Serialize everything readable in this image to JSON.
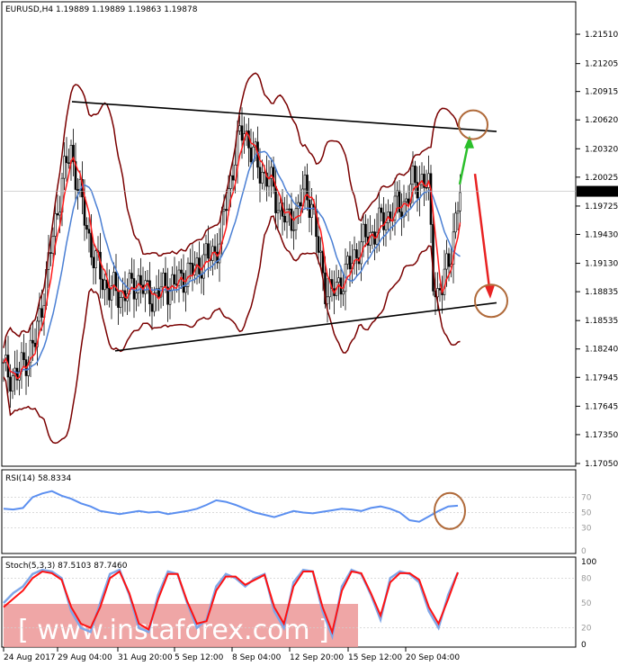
{
  "chart_data": [
    {
      "type": "candlestick",
      "panel": "main",
      "title": "EURUSD,H4  1.19889 1.19889 1.19863 1.19878",
      "last_price_label": "1.19878",
      "yticks": [
        "1.21510",
        "1.21205",
        "1.20915",
        "1.20620",
        "1.20320",
        "1.20025",
        "1.19725",
        "1.19430",
        "1.19130",
        "1.18835",
        "1.18535",
        "1.18240",
        "1.17945",
        "1.17645",
        "1.17350",
        "1.17050"
      ],
      "ylim": [
        1.1705,
        1.2166
      ],
      "price_path": [
        [
          0,
          1.1802
        ],
        [
          6,
          1.1795
        ],
        [
          10,
          1.1815
        ],
        [
          14,
          1.183
        ],
        [
          18,
          1.1885
        ],
        [
          22,
          1.194
        ],
        [
          26,
          1.2
        ],
        [
          30,
          1.203
        ],
        [
          33,
          1.1995
        ],
        [
          36,
          1.196
        ],
        [
          40,
          1.192
        ],
        [
          44,
          1.1895
        ],
        [
          48,
          1.1885
        ],
        [
          52,
          1.188
        ],
        [
          56,
          1.1885
        ],
        [
          60,
          1.1895
        ],
        [
          64,
          1.188
        ],
        [
          68,
          1.188
        ],
        [
          72,
          1.189
        ],
        [
          76,
          1.189
        ],
        [
          80,
          1.19
        ],
        [
          84,
          1.1905
        ],
        [
          88,
          1.1915
        ],
        [
          92,
          1.192
        ],
        [
          96,
          1.1935
        ],
        [
          100,
          1.199
        ],
        [
          104,
          1.2035
        ],
        [
          107,
          1.2055
        ],
        [
          110,
          1.203
        ],
        [
          114,
          1.201
        ],
        [
          118,
          1.2
        ],
        [
          122,
          1.1975
        ],
        [
          126,
          1.1955
        ],
        [
          130,
          1.1965
        ],
        [
          134,
          1.199
        ],
        [
          137,
          1.1975
        ],
        [
          140,
          1.1925
        ],
        [
          143,
          1.189
        ],
        [
          146,
          1.188
        ],
        [
          150,
          1.1895
        ],
        [
          154,
          1.191
        ],
        [
          158,
          1.193
        ],
        [
          162,
          1.194
        ],
        [
          166,
          1.195
        ],
        [
          170,
          1.196
        ],
        [
          174,
          1.197
        ],
        [
          178,
          1.1975
        ],
        [
          182,
          1.1995
        ],
        [
          186,
          1.2
        ],
        [
          189,
          1.199
        ],
        [
          191,
          1.19
        ],
        [
          193,
          1.188
        ],
        [
          195,
          1.1885
        ],
        [
          197,
          1.191
        ],
        [
          199,
          1.193
        ],
        [
          201,
          1.1955
        ],
        [
          203,
          1.1985
        ]
      ],
      "annotations": [
        "upper trendline",
        "lower trendline",
        "green up arrow",
        "red down arrow",
        "brown circles"
      ]
    },
    {
      "type": "line",
      "panel": "rsi",
      "title": "RSI(14) 58.8334",
      "yticks": [
        "70",
        "50",
        "30",
        "0"
      ],
      "ylim": [
        0,
        100
      ],
      "values": [
        55,
        54,
        56,
        70,
        75,
        78,
        72,
        68,
        62,
        58,
        52,
        50,
        48,
        50,
        52,
        50,
        51,
        48,
        50,
        52,
        55,
        60,
        66,
        64,
        60,
        55,
        50,
        47,
        44,
        48,
        52,
        50,
        49,
        51,
        53,
        55,
        54,
        52,
        56,
        58,
        55,
        50,
        40,
        38,
        45,
        52,
        58,
        59
      ]
    },
    {
      "type": "line",
      "panel": "stochastic",
      "title": "Stoch(5,3,3) 87.5103 87.7460",
      "yticks": [
        "100",
        "80",
        "50",
        "20",
        "0"
      ],
      "ylim": [
        0,
        100
      ],
      "series": [
        {
          "values": [
            50,
            62,
            70,
            85,
            90,
            88,
            80,
            40,
            20,
            15,
            50,
            85,
            90,
            60,
            20,
            15,
            60,
            88,
            85,
            50,
            20,
            30,
            70,
            85,
            80,
            70,
            80,
            85,
            40,
            20,
            75,
            90,
            88,
            40,
            10,
            70,
            90,
            85,
            60,
            30,
            80,
            88,
            85,
            75,
            40,
            20,
            60,
            87
          ]
        },
        {
          "values": [
            45,
            55,
            65,
            80,
            88,
            86,
            78,
            45,
            25,
            20,
            45,
            80,
            88,
            62,
            25,
            18,
            55,
            85,
            85,
            52,
            25,
            28,
            65,
            82,
            82,
            72,
            78,
            84,
            45,
            25,
            70,
            88,
            88,
            45,
            15,
            65,
            88,
            86,
            62,
            35,
            75,
            86,
            86,
            78,
            45,
            25,
            55,
            87
          ]
        }
      ]
    }
  ],
  "xaxis": {
    "labels": [
      "24 Aug 2017",
      "29 Aug 04:00",
      "31 Aug 20:00",
      "5 Sep 12:00",
      "8 Sep 04:00",
      "12 Sep 20:00",
      "15 Sep 12:00",
      "20 Sep 04:00"
    ]
  },
  "watermark": "[  www.instaforex.com  ]",
  "colors": {
    "candle": "#000000",
    "bollinger": "#7a0000",
    "ma_red": "#ff1a1a",
    "ma_blue": "#4a7fd4",
    "rsi": "#5b8ff0",
    "stoch_main": "#7fa7e8",
    "stoch_signal": "#ff1111",
    "arrow_up": "#2bbf2b",
    "arrow_down": "#e82222",
    "circle": "#b06a3a",
    "watermark_bg": "#ec9696"
  }
}
